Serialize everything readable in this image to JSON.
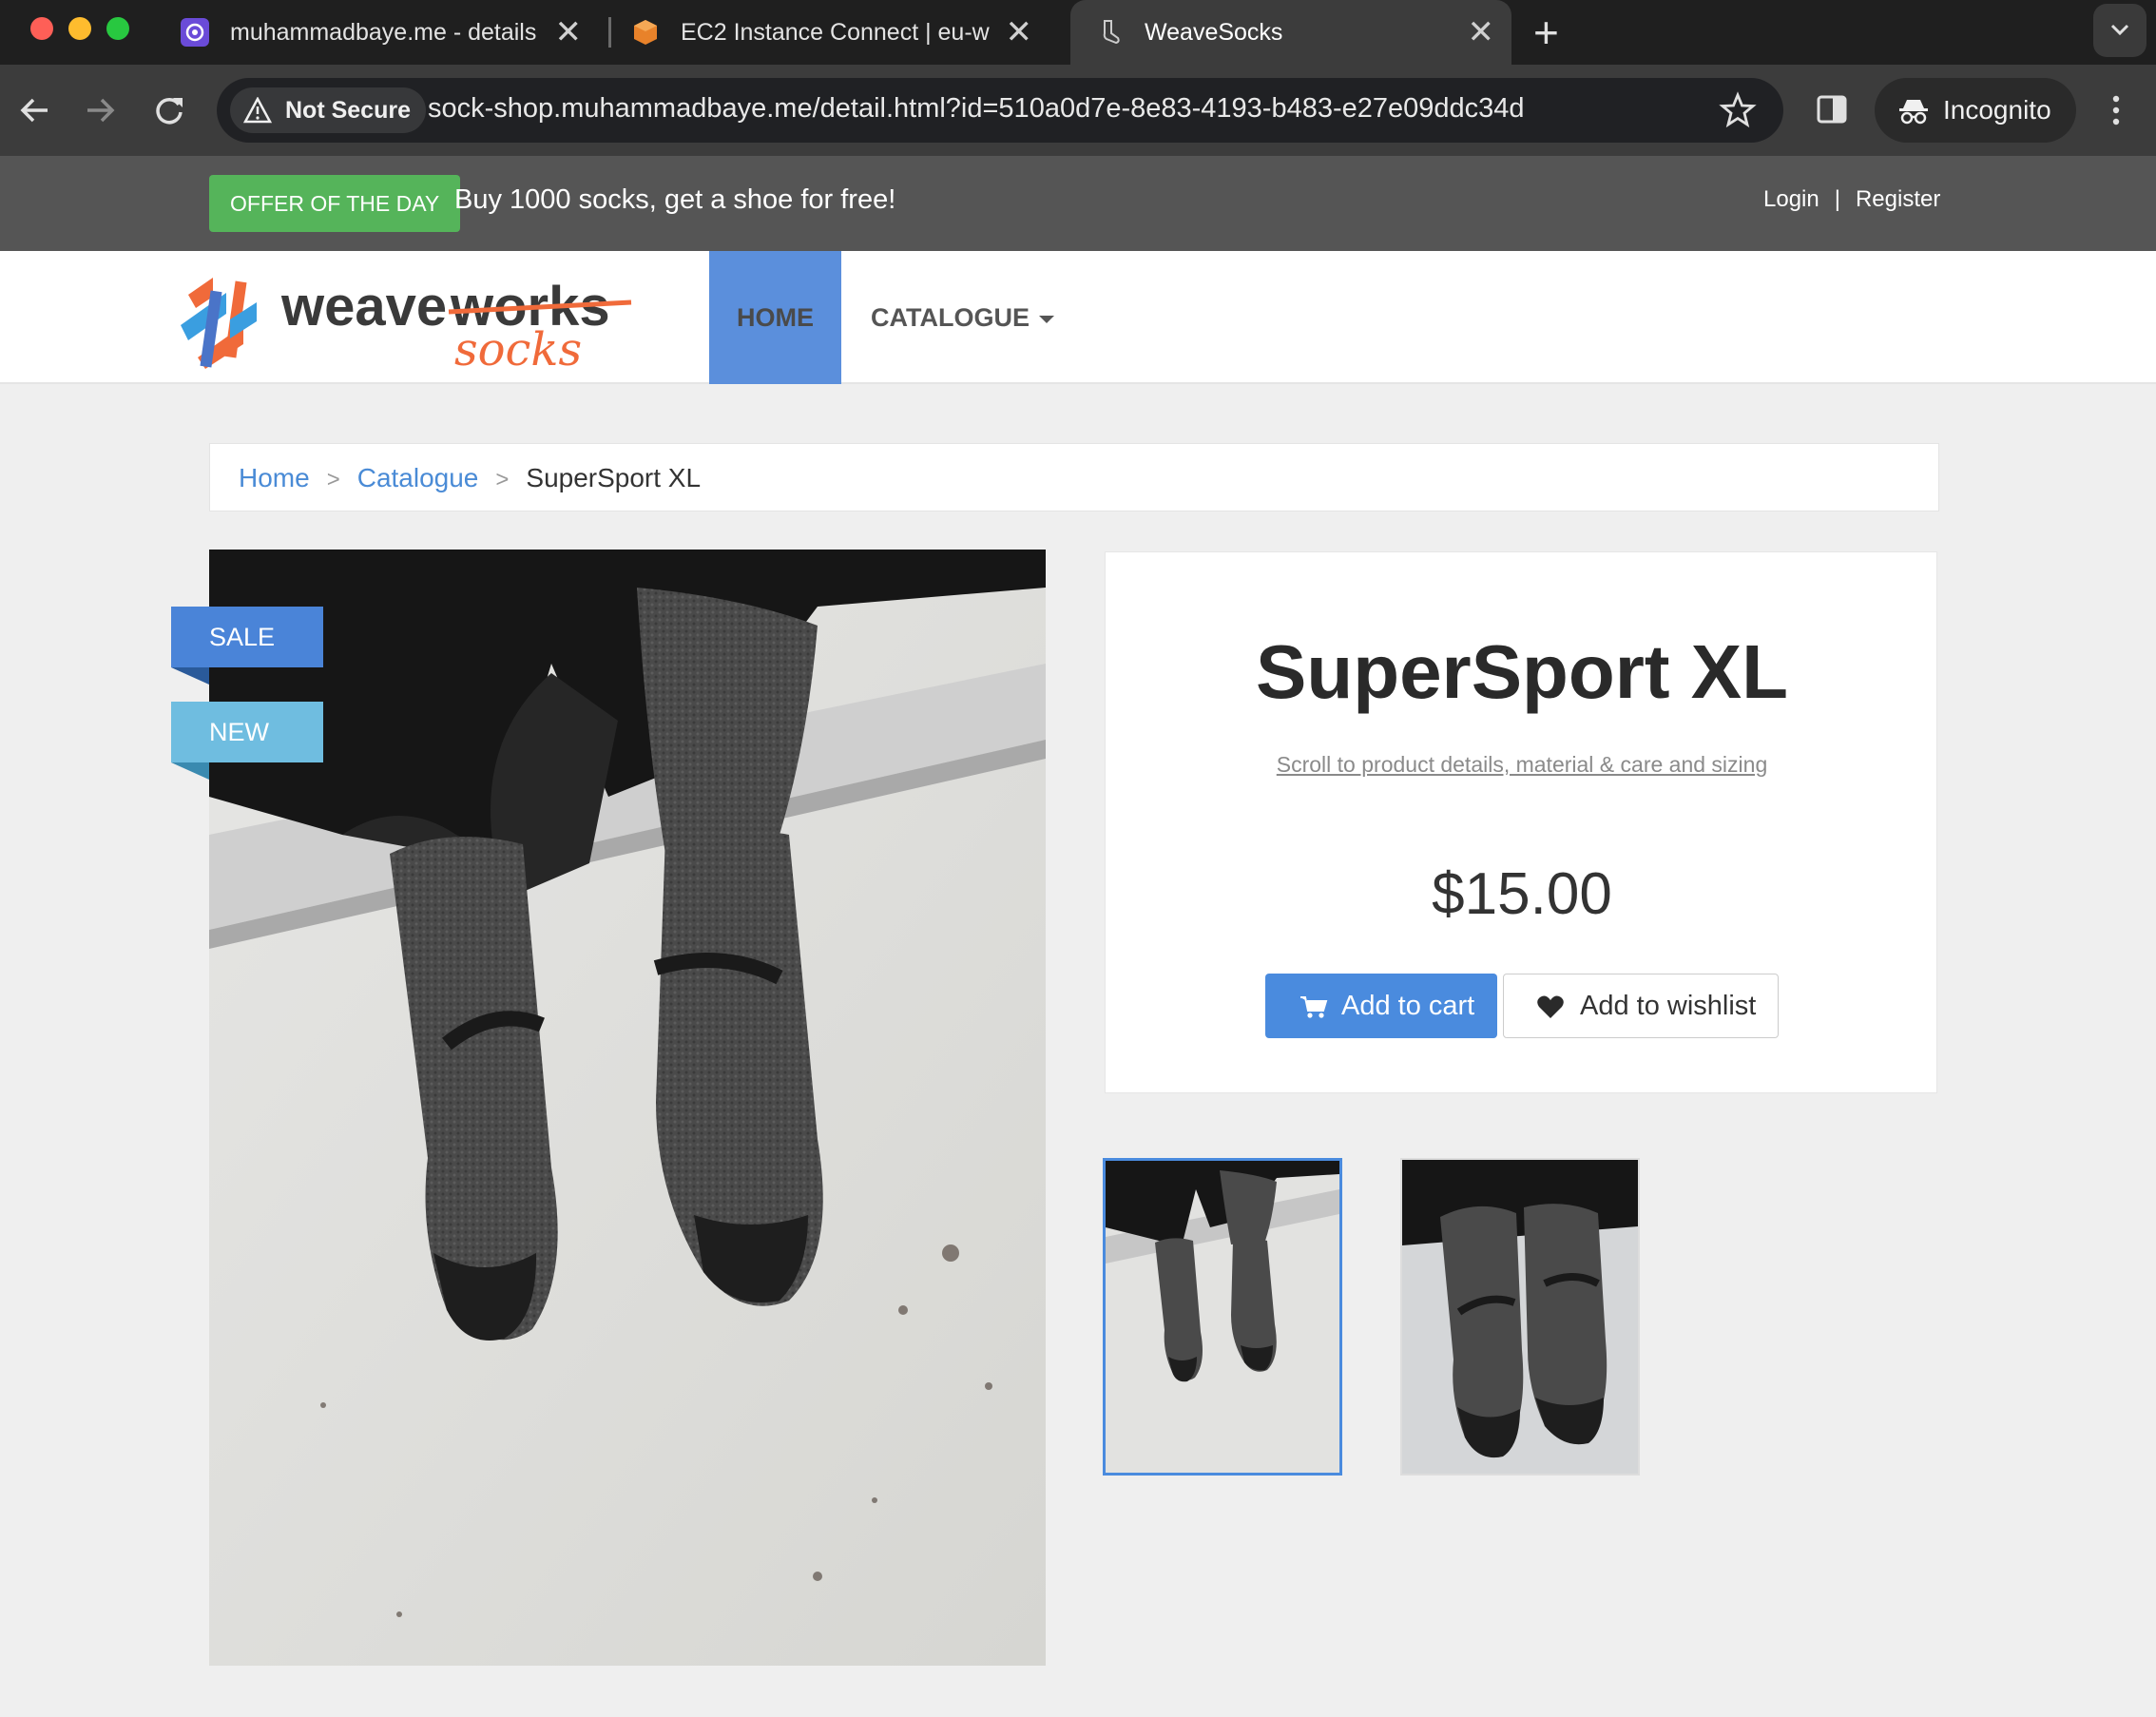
{
  "browser": {
    "tabs": [
      {
        "title": "muhammadbaye.me - details",
        "favicon": "shield-logo-icon"
      },
      {
        "title": "EC2 Instance Connect | eu-w",
        "favicon": "aws-box-icon"
      },
      {
        "title": "WeaveSocks",
        "favicon": "sock-icon",
        "active": true
      }
    ],
    "close_glyph": "✕",
    "new_tab_glyph": "+",
    "security_label": "Not Secure",
    "url": "sock-shop.muhammadbaye.me/detail.html?id=510a0d7e-8e83-4193-b483-e27e09ddc34d",
    "incognito_label": "Incognito"
  },
  "topbar": {
    "offer_badge": "OFFER OF THE DAY",
    "offer_text": "Buy 1000 socks, get a shoe for free!",
    "login": "Login",
    "separator": "|",
    "register": "Register"
  },
  "nav": {
    "logo_word1": "weave",
    "logo_word2": "works",
    "logo_word3": "socks",
    "home": "HOME",
    "catalogue": "CATALOGUE"
  },
  "breadcrumb": {
    "home": "Home",
    "catalogue": "Catalogue",
    "current": "SuperSport XL",
    "separator": ">"
  },
  "product": {
    "ribbon_sale": "SALE",
    "ribbon_new": "NEW",
    "title": "SuperSport XL",
    "scroll_link": "Scroll to product details, material & care and sizing",
    "price": "$15.00",
    "add_to_cart": "Add to cart",
    "add_to_wishlist": "Add to wishlist"
  },
  "colors": {
    "accent_blue": "#4a8bde",
    "offer_green": "#55b45a",
    "nav_active": "#5b8fdc",
    "ribbon_sale": "#4a84d8",
    "ribbon_new": "#6fbde0",
    "logo_orange": "#f06a3a"
  }
}
